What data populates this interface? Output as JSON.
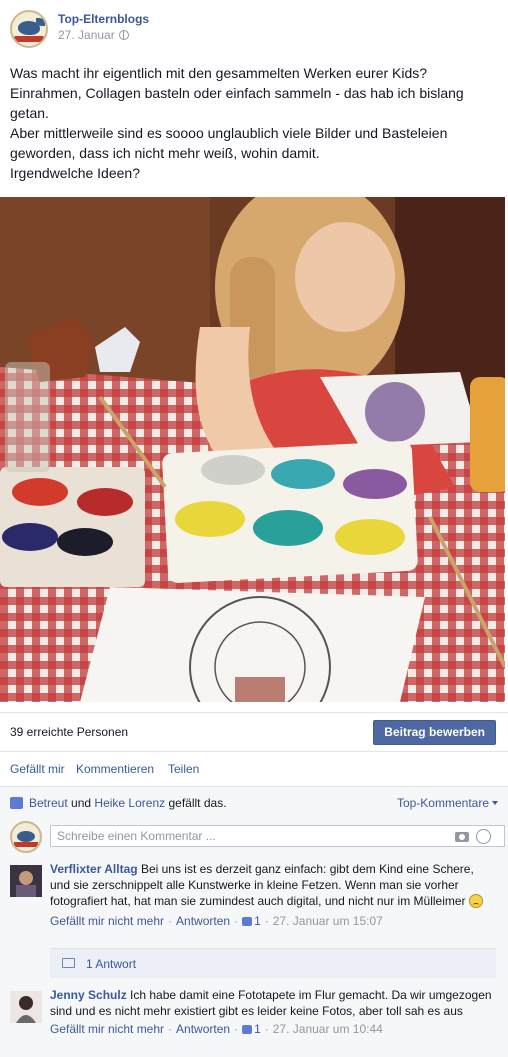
{
  "post": {
    "page_name": "Top-Elternblogs",
    "date": "27. Januar",
    "privacy_icon": "globe-icon",
    "text_lines": [
      "Was macht ihr eigentlich mit den gesammelten Werken eurer Kids?",
      "Einrahmen, Collagen basteln oder einfach sammeln - das hab ich bislang",
      "getan.",
      "Aber mittlerweile sind es soooo unglaublich viele Bilder und Basteleien",
      "geworden, dass ich nicht mehr weiß, wohin damit.",
      "Irgendwelche Ideen?"
    ]
  },
  "stats": {
    "reach": "39 erreichte Personen",
    "boost_label": "Beitrag bewerben"
  },
  "actions": {
    "like": "Gefällt mir",
    "comment": "Kommentieren",
    "share": "Teilen"
  },
  "likes": {
    "user1": "Betreut",
    "and": "und",
    "user2": "Heike Lorenz",
    "suffix": "gefällt das.",
    "sort_label": "Top-Kommentare"
  },
  "composer": {
    "placeholder": "Schreibe einen Kommentar ..."
  },
  "comments": [
    {
      "author": "Verflixter Alltag",
      "text": "Bei uns ist es derzeit ganz einfach: gibt dem Kind eine Schere, und sie zerschnippelt alle Kunstwerke in kleine Fetzen. Wenn man sie vorher fotografiert hat, hat man sie zumindest auch digital, und nicht nur im Mülleimer",
      "like_label": "Gefällt mir nicht mehr",
      "reply_label": "Antworten",
      "likes": "1",
      "time": "27. Januar um 15:07"
    },
    {
      "author": "Jenny Schulz",
      "text": "Ich habe damit eine Fototapete im Flur gemacht. Da wir umgezogen sind und es nicht mehr existiert gibt es leider keine Fotos, aber toll sah es aus",
      "like_label": "Gefällt mir nicht mehr",
      "reply_label": "Antworten",
      "likes": "1",
      "time": "27. Januar um 10:44"
    }
  ],
  "replies": {
    "label": "1 Antwort"
  },
  "colors": {
    "link": "#3b5998",
    "button": "#4e69a2",
    "muted": "#9197a3"
  }
}
